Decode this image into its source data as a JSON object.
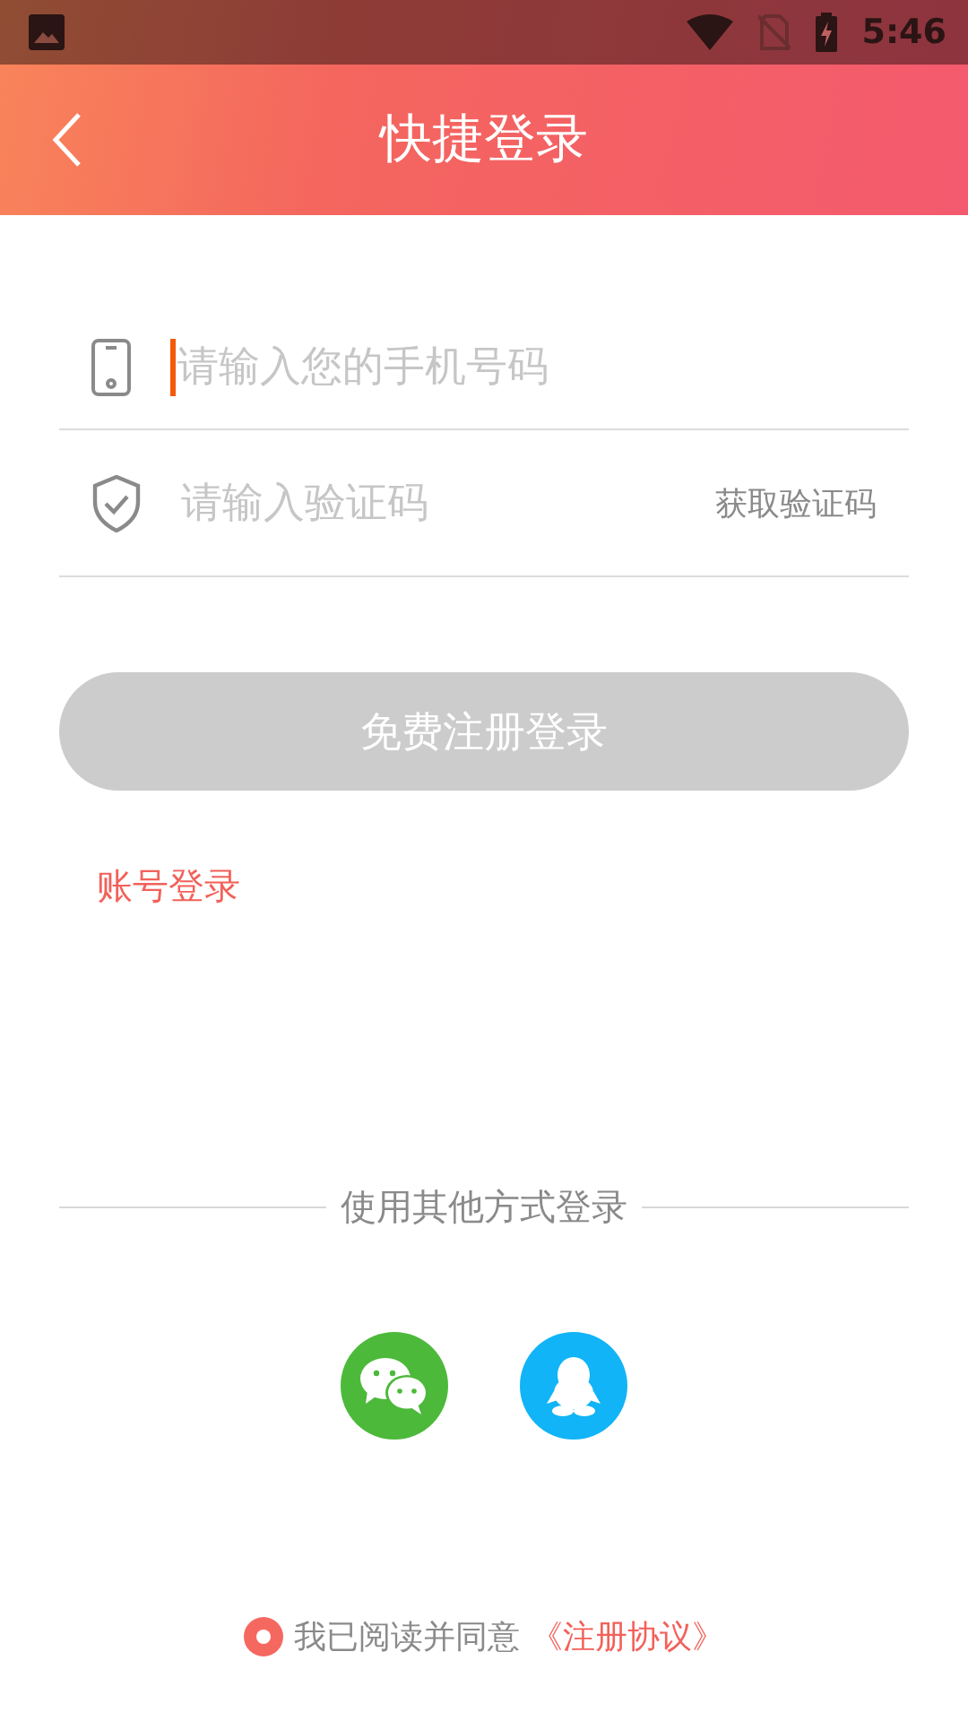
{
  "status_bar": {
    "time": "5:46"
  },
  "header": {
    "title": "快捷登录"
  },
  "fields": [
    {
      "kind": "phone",
      "placeholder": "请输入您的手机号码",
      "focused": true
    },
    {
      "kind": "code",
      "placeholder": "请输入验证码",
      "focused": false,
      "action": "获取验证码"
    }
  ],
  "submit": {
    "label": "免费注册登录",
    "disabled": true
  },
  "account_link": "账号登录",
  "other_login": {
    "label": "使用其他方式登录",
    "providers": [
      {
        "kind": "wechat"
      },
      {
        "kind": "qq"
      }
    ]
  },
  "agreement": {
    "checked": true,
    "text": "我已阅读并同意",
    "link": "《注册协议》"
  }
}
